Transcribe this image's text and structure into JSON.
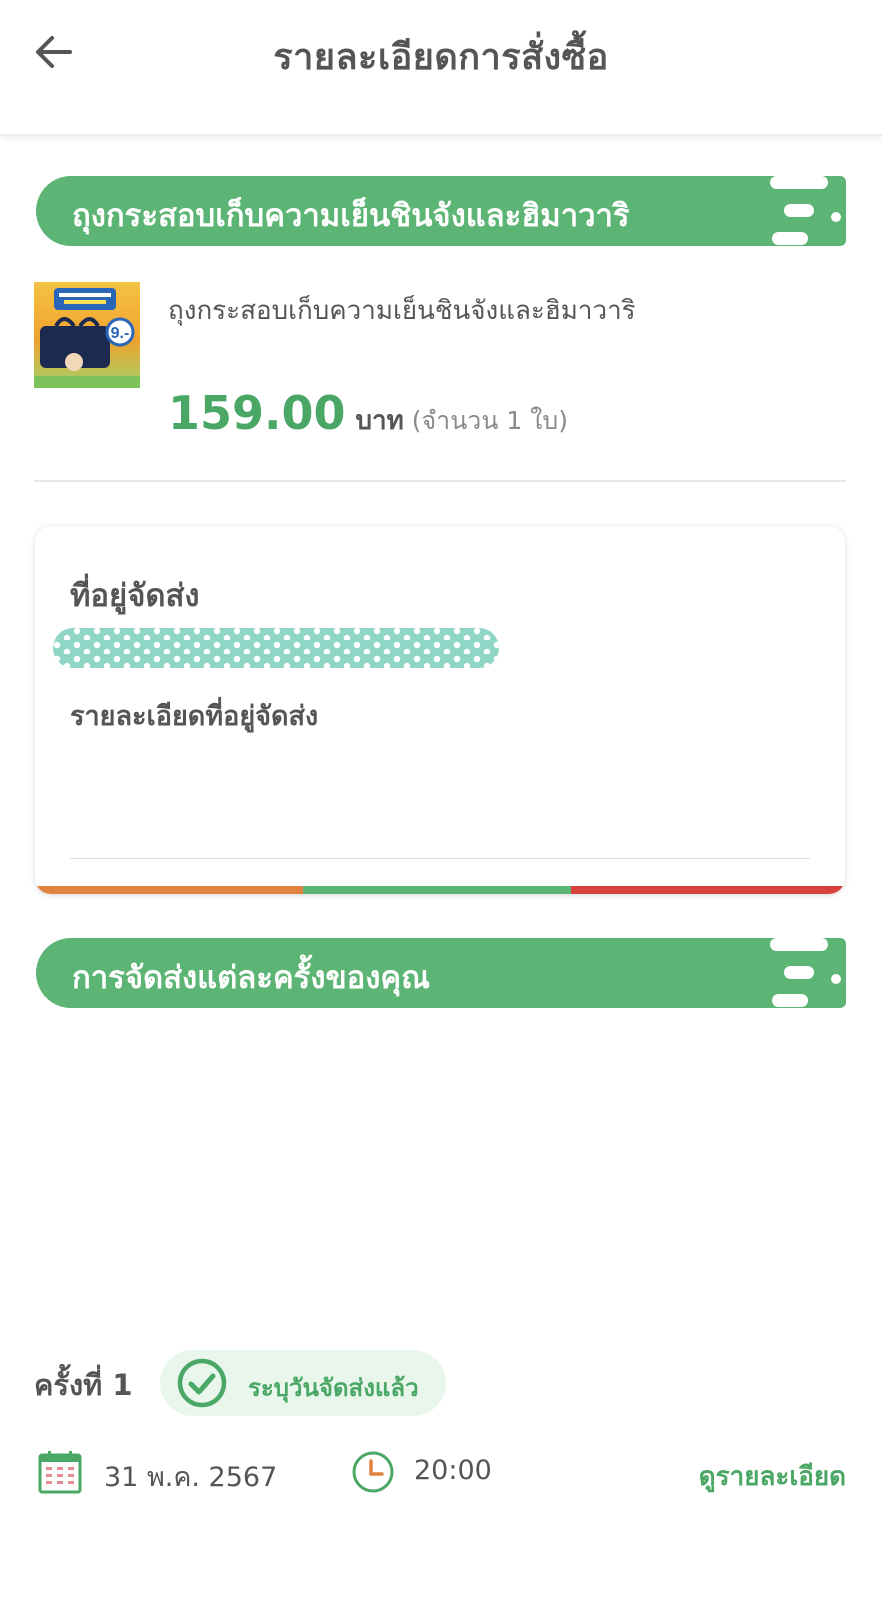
{
  "header": {
    "title": "รายละเอียดการสั่งซื้อ",
    "back_icon": "arrow-left-icon"
  },
  "product_section": {
    "banner_title": "ถุงกระสอบเก็บความเย็นชินจังและฮิมาวาริ",
    "item": {
      "name": "ถุงกระสอบเก็บความเย็นชินจังและฮิมาวาริ",
      "price": "159.00",
      "currency": "บาท",
      "quantity_text": "(จำนวน 1 ใบ)",
      "thumbnail_badge": "9.-"
    }
  },
  "address_card": {
    "title": "ที่อยู่จัดส่ง",
    "redacted_name": "",
    "detail_label": "รายละเอียดที่อยู่จัดส่ง",
    "stripe_colors": [
      "#e0833f",
      "#5cb574",
      "#d8433b"
    ]
  },
  "delivery_section": {
    "banner_title": "การจัดส่งแต่ละครั้งของคุณ",
    "rounds": [
      {
        "round_label": "ครั้งที่ 1",
        "status": "ระบุวันจัดส่งแล้ว",
        "date": "31 พ.ค. 2567",
        "time": "20:00",
        "detail_link": "ดูรายละเอียด"
      }
    ]
  },
  "colors": {
    "brand_green": "#5cb574",
    "text_green": "#4aa765",
    "status_bg": "#e8f6ec",
    "text_gray": "#555555",
    "accent_orange": "#e0833f",
    "accent_red": "#d8433b"
  }
}
